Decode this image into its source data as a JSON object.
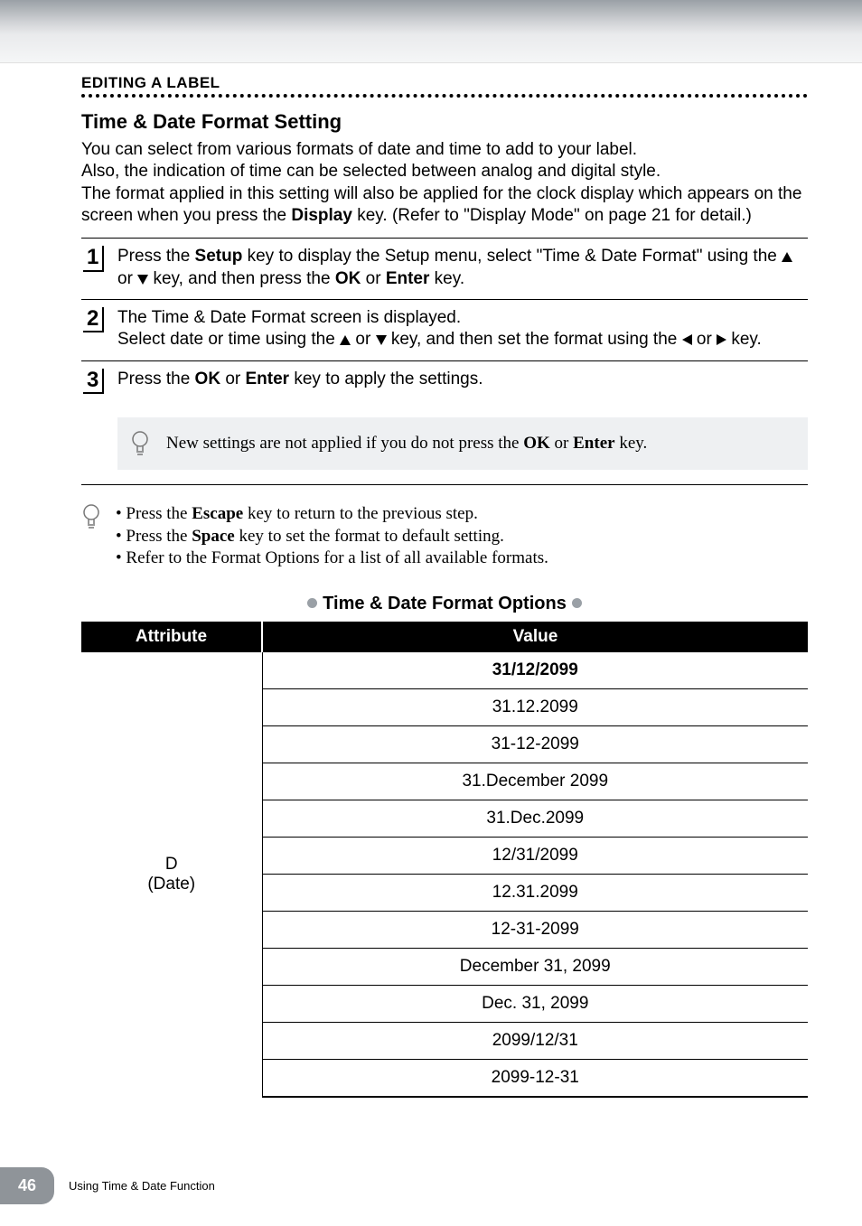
{
  "header": {
    "section": "EDITING A LABEL"
  },
  "main": {
    "title": "Time & Date Format Setting",
    "intro_parts": {
      "p1a": "You can select from various formats of date and time to add to your label.",
      "p1b": "Also, the indication of time can be selected between analog and digital style.",
      "p1c_a": "The format applied in this setting will also be applied for the clock display which appears on the screen when you press the ",
      "p1c_key": "Display",
      "p1c_b": " key. (Refer to \"Display Mode\" on page 21 for detail.)"
    },
    "steps": [
      {
        "num": "1",
        "t1": "Press the ",
        "k1": "Setup",
        "t2": " key to display the Setup menu, select \"Time & Date Format\" using the ",
        "t3": " or ",
        "t4": " key, and then press the ",
        "k2": "OK",
        "t5": " or ",
        "k3": "Enter",
        "t6": " key."
      },
      {
        "num": "2",
        "t1": "The Time & Date Format screen is displayed.",
        "t2": "Select date or time using the ",
        "t3": " or ",
        "t4": " key, and then set the format using the ",
        "t5": " or ",
        "t6": " key."
      },
      {
        "num": "3",
        "t1": "Press the ",
        "k1": "OK",
        "t2": " or ",
        "k2": "Enter",
        "t3": " key to apply the settings."
      }
    ],
    "tip": {
      "t1": "New settings are not applied if you do not press the ",
      "k1": "OK",
      "t2": " or ",
      "k2": "Enter",
      "t3": " key."
    },
    "notes": {
      "n1a": "Press the ",
      "n1k": "Escape",
      "n1b": " key to return to the previous step.",
      "n2a": "Press the ",
      "n2k": "Space",
      "n2b": " key to set the format to default setting.",
      "n3": "Refer to the Format Options for a list of all available formats."
    }
  },
  "table": {
    "caption": "Time & Date Format Options",
    "headers": {
      "attr": "Attribute",
      "val": "Value"
    },
    "attr_label_line1": "D",
    "attr_label_line2": "(Date)",
    "values": [
      "31/12/2099",
      "31.12.2099",
      "31-12-2099",
      "31.December 2099",
      "31.Dec.2099",
      "12/31/2099",
      "12.31.2099",
      "12-31-2099",
      "December 31, 2099",
      "Dec. 31, 2099",
      "2099/12/31",
      "2099-12-31"
    ]
  },
  "footer": {
    "page": "46",
    "text": "Using Time & Date Function"
  },
  "icons": {
    "bulb": "lightbulb-icon",
    "up": "triangle-up-icon",
    "down": "triangle-down-icon",
    "left": "triangle-left-icon",
    "right": "triangle-right-icon"
  }
}
